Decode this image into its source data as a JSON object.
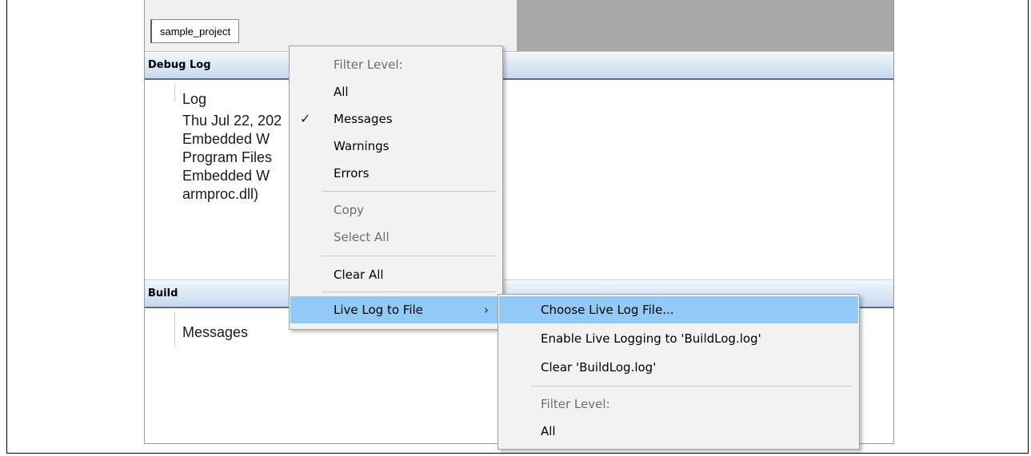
{
  "tab": {
    "label": "sample_project"
  },
  "debug_log": {
    "header": "Debug Log",
    "column_header": "Log",
    "lines": [
      "Thu Jul 22, 202",
      "Embedded W",
      "Program Files",
      "Embedded W",
      "armproc.dll)"
    ]
  },
  "build": {
    "header": "Build",
    "column_header": "Messages"
  },
  "context_menu": {
    "filter_label": "Filter Level:",
    "all": "All",
    "messages": "Messages",
    "messages_check": "✓",
    "warnings": "Warnings",
    "errors": "Errors",
    "copy": "Copy",
    "select_all": "Select All",
    "clear_all": "Clear All",
    "live_log": "Live Log to File",
    "live_log_arrow": "›"
  },
  "submenu": {
    "choose": "Choose Live Log File...",
    "enable": "Enable Live Logging to 'BuildLog.log'",
    "clear": "Clear 'BuildLog.log'",
    "filter_label": "Filter Level:",
    "all": "All"
  },
  "colors": {
    "highlight": "#91c9f7",
    "panel_header_top": "#eff5fb",
    "panel_header_bottom": "#c7d9ee",
    "menu_background": "#f2f2f2"
  }
}
